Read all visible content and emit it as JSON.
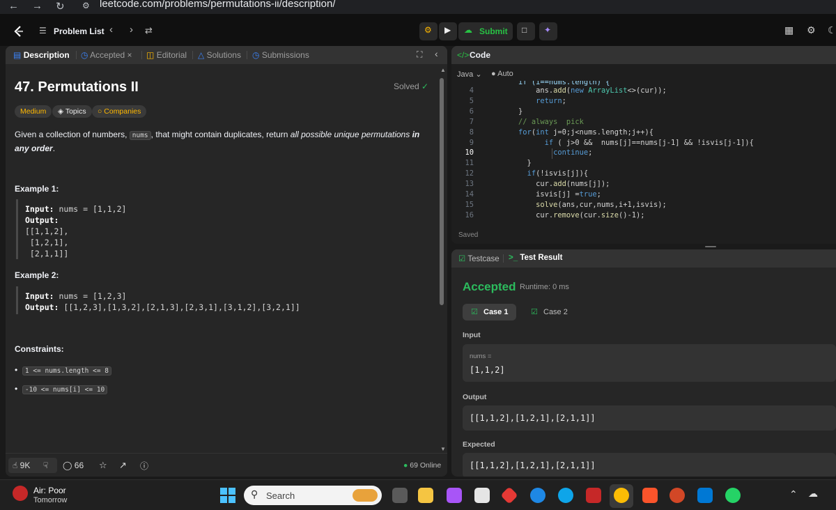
{
  "browser": {
    "url": "leetcode.com/problems/permutations-ii/description/"
  },
  "topbar": {
    "problem_list": "Problem List",
    "submit": "Submit"
  },
  "left_tabs": [
    "Description",
    "Accepted",
    "Editorial",
    "Solutions",
    "Submissions"
  ],
  "problem": {
    "title": "47. Permutations II",
    "solved": "Solved",
    "difficulty": "Medium",
    "topics": "Topics",
    "companies": "Companies",
    "statement_1": "Given a collection of numbers,",
    "statement_code": "nums",
    "statement_2": ", that might contain duplicates, return",
    "statement_em": "all possible unique permutations",
    "statement_bold": "in any order",
    "statement_end": ".",
    "example1_title": "Example 1:",
    "example1_input_label": "Input:",
    "example1_input": "nums = [1,1,2]",
    "example1_output_label": "Output:",
    "example1_output_lines": [
      "[[1,1,2],",
      " [1,2,1],",
      " [2,1,1]]"
    ],
    "example2_title": "Example 2:",
    "example2_input_label": "Input:",
    "example2_input": "nums = [1,2,3]",
    "example2_output_label": "Output:",
    "example2_output": "[[1,2,3],[1,3,2],[2,1,3],[2,3,1],[3,1,2],[3,2,1]]",
    "constraints_title": "Constraints:",
    "constraints": [
      "1 <= nums.length <= 8",
      "-10 <= nums[i] <= 10"
    ]
  },
  "footer": {
    "likes": "9K",
    "comments": "66",
    "online": "69 Online"
  },
  "code_panel": {
    "title": "Code",
    "language": "Java",
    "auto": "Auto",
    "saved": "Saved",
    "current_line": 10,
    "lines": [
      {
        "n": 4,
        "text": "            ans.add(new ArrayList<>(cur));"
      },
      {
        "n": 5,
        "text": "            return;"
      },
      {
        "n": 6,
        "text": "        }"
      },
      {
        "n": 7,
        "text": "        // always  pick"
      },
      {
        "n": 8,
        "text": "        for(int j=0;j<nums.length;j++){"
      },
      {
        "n": 9,
        "text": "              if ( j>0 &&  nums[j]==nums[j-1] && !isvis[j-1]){"
      },
      {
        "n": 10,
        "text": "                continue;"
      },
      {
        "n": 11,
        "text": "          }"
      },
      {
        "n": 12,
        "text": "          if(!isvis[j]){"
      },
      {
        "n": 13,
        "text": "            cur.add(nums[j]);"
      },
      {
        "n": 14,
        "text": "            isvis[j] =true;"
      },
      {
        "n": 15,
        "text": "            solve(ans,cur,nums,i+1,isvis);"
      },
      {
        "n": 16,
        "text": "            cur.remove(cur.size()-1);"
      }
    ]
  },
  "result_panel": {
    "tab_testcase": "Testcase",
    "tab_result": "Test Result",
    "status": "Accepted",
    "runtime": "Runtime: 0 ms",
    "case1": "Case 1",
    "case2": "Case 2",
    "input_label": "Input",
    "input_var": "nums =",
    "input_value": "[1,1,2]",
    "output_label": "Output",
    "output_value": "[[1,1,2],[1,2,1],[2,1,1]]",
    "expected_label": "Expected",
    "expected_value": "[[1,1,2],[1,2,1],[2,1,1]]"
  },
  "taskbar": {
    "weather_title": "Air: Poor",
    "weather_sub": "Tomorrow",
    "search": "Search"
  },
  "colors": {
    "accepted": "#2cbb5d",
    "medium": "#ffb800",
    "green_submit": "#28c244"
  }
}
